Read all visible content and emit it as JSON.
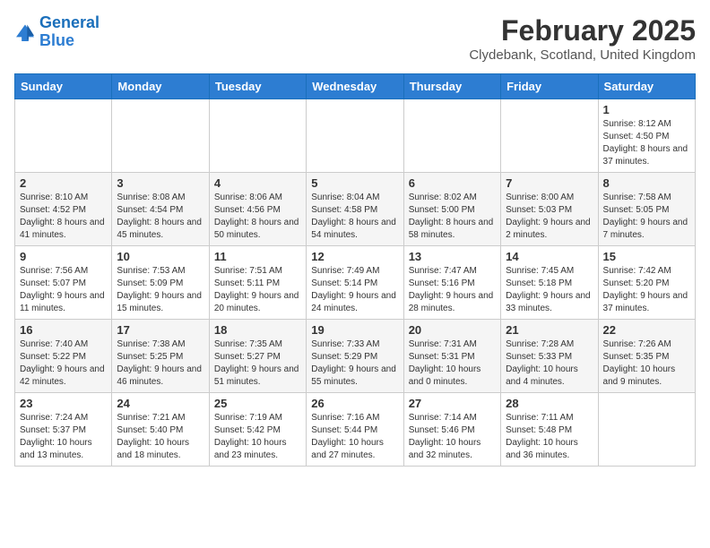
{
  "header": {
    "logo_line1": "General",
    "logo_line2": "Blue",
    "month": "February 2025",
    "location": "Clydebank, Scotland, United Kingdom"
  },
  "days_of_week": [
    "Sunday",
    "Monday",
    "Tuesday",
    "Wednesday",
    "Thursday",
    "Friday",
    "Saturday"
  ],
  "weeks": [
    [
      {
        "day": "",
        "info": ""
      },
      {
        "day": "",
        "info": ""
      },
      {
        "day": "",
        "info": ""
      },
      {
        "day": "",
        "info": ""
      },
      {
        "day": "",
        "info": ""
      },
      {
        "day": "",
        "info": ""
      },
      {
        "day": "1",
        "info": "Sunrise: 8:12 AM\nSunset: 4:50 PM\nDaylight: 8 hours and 37 minutes."
      }
    ],
    [
      {
        "day": "2",
        "info": "Sunrise: 8:10 AM\nSunset: 4:52 PM\nDaylight: 8 hours and 41 minutes."
      },
      {
        "day": "3",
        "info": "Sunrise: 8:08 AM\nSunset: 4:54 PM\nDaylight: 8 hours and 45 minutes."
      },
      {
        "day": "4",
        "info": "Sunrise: 8:06 AM\nSunset: 4:56 PM\nDaylight: 8 hours and 50 minutes."
      },
      {
        "day": "5",
        "info": "Sunrise: 8:04 AM\nSunset: 4:58 PM\nDaylight: 8 hours and 54 minutes."
      },
      {
        "day": "6",
        "info": "Sunrise: 8:02 AM\nSunset: 5:00 PM\nDaylight: 8 hours and 58 minutes."
      },
      {
        "day": "7",
        "info": "Sunrise: 8:00 AM\nSunset: 5:03 PM\nDaylight: 9 hours and 2 minutes."
      },
      {
        "day": "8",
        "info": "Sunrise: 7:58 AM\nSunset: 5:05 PM\nDaylight: 9 hours and 7 minutes."
      }
    ],
    [
      {
        "day": "9",
        "info": "Sunrise: 7:56 AM\nSunset: 5:07 PM\nDaylight: 9 hours and 11 minutes."
      },
      {
        "day": "10",
        "info": "Sunrise: 7:53 AM\nSunset: 5:09 PM\nDaylight: 9 hours and 15 minutes."
      },
      {
        "day": "11",
        "info": "Sunrise: 7:51 AM\nSunset: 5:11 PM\nDaylight: 9 hours and 20 minutes."
      },
      {
        "day": "12",
        "info": "Sunrise: 7:49 AM\nSunset: 5:14 PM\nDaylight: 9 hours and 24 minutes."
      },
      {
        "day": "13",
        "info": "Sunrise: 7:47 AM\nSunset: 5:16 PM\nDaylight: 9 hours and 28 minutes."
      },
      {
        "day": "14",
        "info": "Sunrise: 7:45 AM\nSunset: 5:18 PM\nDaylight: 9 hours and 33 minutes."
      },
      {
        "day": "15",
        "info": "Sunrise: 7:42 AM\nSunset: 5:20 PM\nDaylight: 9 hours and 37 minutes."
      }
    ],
    [
      {
        "day": "16",
        "info": "Sunrise: 7:40 AM\nSunset: 5:22 PM\nDaylight: 9 hours and 42 minutes."
      },
      {
        "day": "17",
        "info": "Sunrise: 7:38 AM\nSunset: 5:25 PM\nDaylight: 9 hours and 46 minutes."
      },
      {
        "day": "18",
        "info": "Sunrise: 7:35 AM\nSunset: 5:27 PM\nDaylight: 9 hours and 51 minutes."
      },
      {
        "day": "19",
        "info": "Sunrise: 7:33 AM\nSunset: 5:29 PM\nDaylight: 9 hours and 55 minutes."
      },
      {
        "day": "20",
        "info": "Sunrise: 7:31 AM\nSunset: 5:31 PM\nDaylight: 10 hours and 0 minutes."
      },
      {
        "day": "21",
        "info": "Sunrise: 7:28 AM\nSunset: 5:33 PM\nDaylight: 10 hours and 4 minutes."
      },
      {
        "day": "22",
        "info": "Sunrise: 7:26 AM\nSunset: 5:35 PM\nDaylight: 10 hours and 9 minutes."
      }
    ],
    [
      {
        "day": "23",
        "info": "Sunrise: 7:24 AM\nSunset: 5:37 PM\nDaylight: 10 hours and 13 minutes."
      },
      {
        "day": "24",
        "info": "Sunrise: 7:21 AM\nSunset: 5:40 PM\nDaylight: 10 hours and 18 minutes."
      },
      {
        "day": "25",
        "info": "Sunrise: 7:19 AM\nSunset: 5:42 PM\nDaylight: 10 hours and 23 minutes."
      },
      {
        "day": "26",
        "info": "Sunrise: 7:16 AM\nSunset: 5:44 PM\nDaylight: 10 hours and 27 minutes."
      },
      {
        "day": "27",
        "info": "Sunrise: 7:14 AM\nSunset: 5:46 PM\nDaylight: 10 hours and 32 minutes."
      },
      {
        "day": "28",
        "info": "Sunrise: 7:11 AM\nSunset: 5:48 PM\nDaylight: 10 hours and 36 minutes."
      },
      {
        "day": "",
        "info": ""
      }
    ]
  ]
}
